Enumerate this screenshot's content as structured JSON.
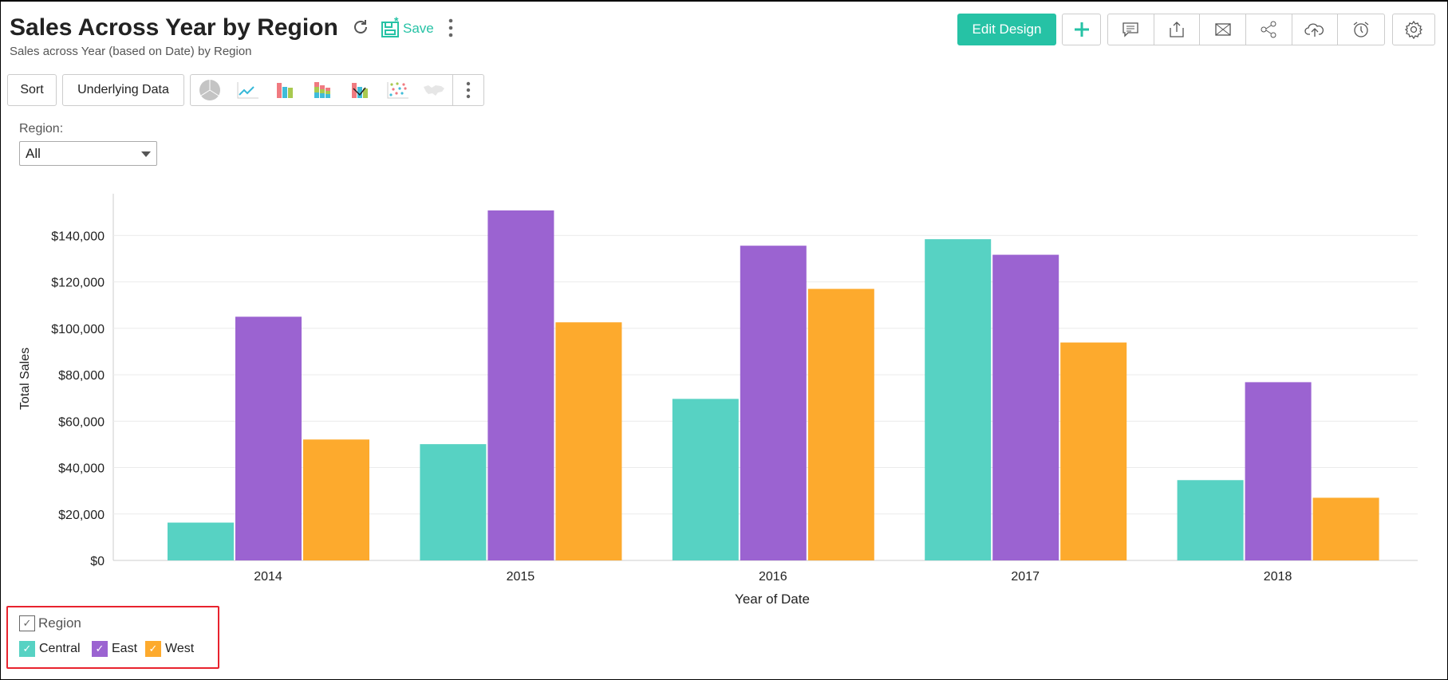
{
  "header": {
    "title": "Sales Across Year by Region",
    "subtitle": "Sales across Year (based on Date) by Region",
    "save_label": "Save",
    "edit_design_label": "Edit Design",
    "accent_color": "#26c2a5"
  },
  "toolbar": {
    "sort_label": "Sort",
    "underlying_data_label": "Underlying Data",
    "chart_type_icons": [
      "pie-chart-icon",
      "line-chart-icon",
      "bar-chart-icon",
      "stacked-bar-chart-icon",
      "combo-chart-icon",
      "scatter-chart-icon",
      "map-chart-icon"
    ],
    "action_icons": [
      "comment-icon",
      "export-icon",
      "email-icon",
      "share-icon",
      "publish-icon",
      "schedule-alarm-icon"
    ]
  },
  "filter": {
    "label": "Region:",
    "value": "All"
  },
  "legend": {
    "title": "Region",
    "items": [
      {
        "label": "Central",
        "color": "#57d2c3"
      },
      {
        "label": "East",
        "color": "#9b63d1"
      },
      {
        "label": "West",
        "color": "#fdaa2d"
      }
    ]
  },
  "chart_data": {
    "type": "bar",
    "title": "",
    "xlabel": "Year of Date",
    "ylabel": "Total Sales",
    "categories": [
      "2014",
      "2015",
      "2016",
      "2017",
      "2018"
    ],
    "ylim": [
      0,
      158000
    ],
    "yticks": [
      0,
      20000,
      40000,
      60000,
      80000,
      100000,
      120000,
      140000
    ],
    "ytick_labels": [
      "$0",
      "$20,000",
      "$40,000",
      "$60,000",
      "$80,000",
      "$100,000",
      "$120,000",
      "$140,000"
    ],
    "grid": true,
    "legend_position": "bottom-left",
    "series": [
      {
        "name": "Central",
        "color": "#57d2c3",
        "values": [
          16300,
          50100,
          69600,
          138400,
          34600
        ]
      },
      {
        "name": "East",
        "color": "#9b63d1",
        "values": [
          105000,
          150800,
          135600,
          131700,
          76800
        ]
      },
      {
        "name": "West",
        "color": "#fdaa2d",
        "values": [
          52100,
          102600,
          117000,
          93900,
          27000
        ]
      }
    ]
  }
}
